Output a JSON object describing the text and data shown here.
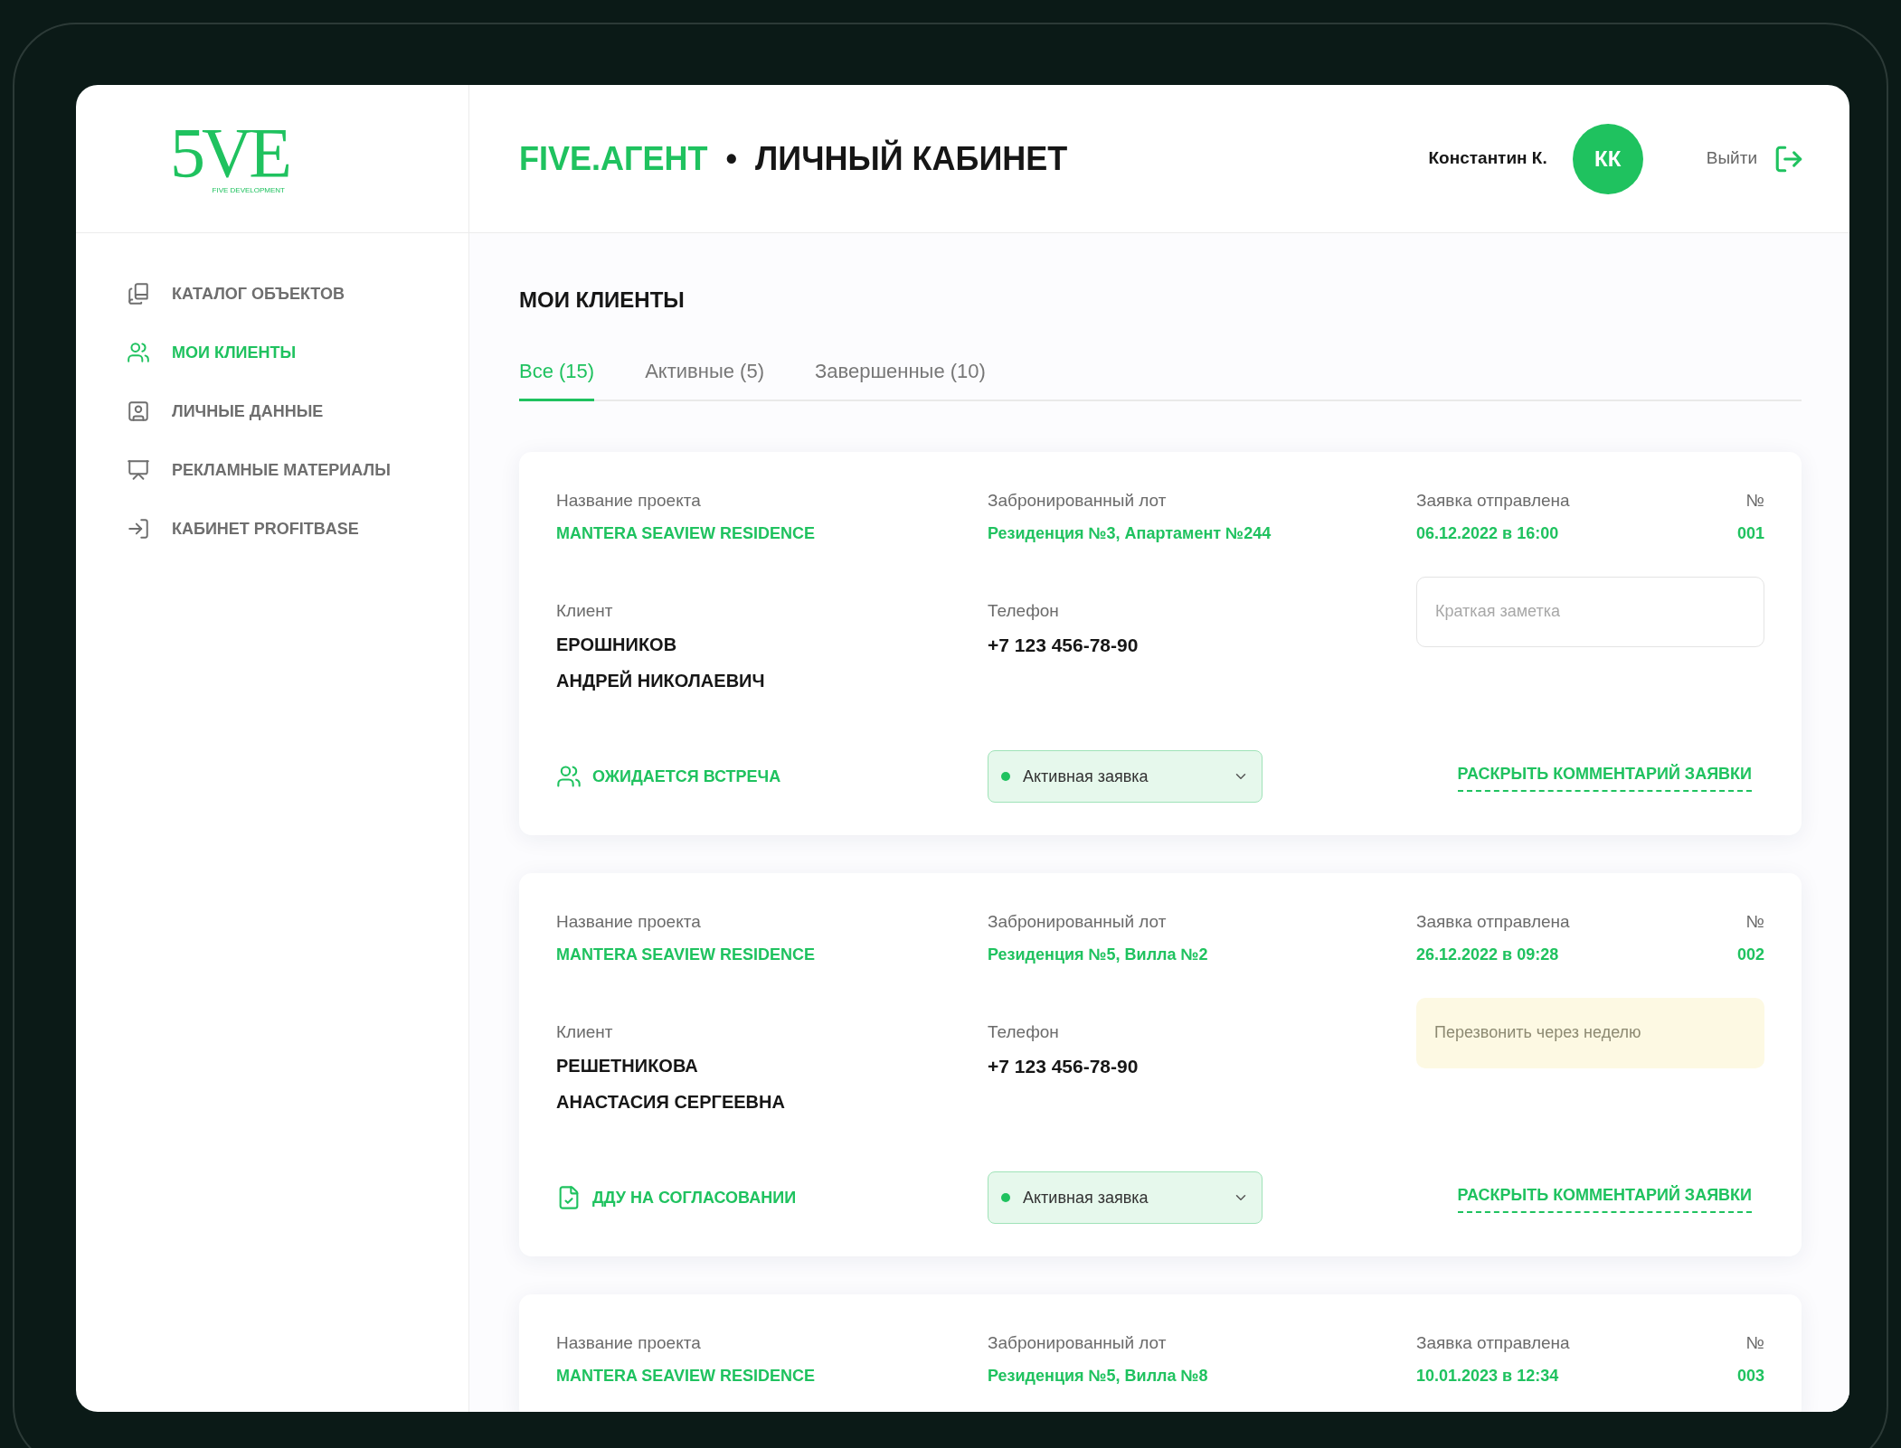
{
  "logo": {
    "mark": "5VE",
    "subtitle": "FIVE DEVELOPMENT"
  },
  "header": {
    "brand": "FIVE.АГЕНТ",
    "separator": "•",
    "title": "ЛИЧНЫЙ КАБИНЕТ",
    "user_name": "Константин К.",
    "avatar_initials": "КК",
    "logout": "Выйти"
  },
  "sidebar": {
    "items": [
      {
        "kind": "catalog",
        "label": "КАТАЛОГ ОБЪЕКТОВ",
        "selected": false
      },
      {
        "kind": "clients",
        "label": "МОИ КЛИЕНТЫ",
        "selected": true
      },
      {
        "kind": "profile",
        "label": "ЛИЧНЫЕ ДАННЫЕ",
        "selected": false
      },
      {
        "kind": "presentation",
        "label": "РЕКЛАМНЫЕ МАТЕРИАЛЫ",
        "selected": false
      },
      {
        "kind": "login",
        "label": "КАБИНЕТ PROFITBASE",
        "selected": false
      }
    ]
  },
  "page_title": "МОИ КЛИЕНТЫ",
  "tabs": [
    {
      "label": "Все (15)",
      "selected": true
    },
    {
      "label": "Активные (5)",
      "selected": false
    },
    {
      "label": "Завершенные (10)",
      "selected": false
    }
  ],
  "cards": [
    {
      "project": {
        "label": "Название проекта",
        "value": "MANTERA SEAVIEW RESIDENCE"
      },
      "lot": {
        "label": "Забронированный лот",
        "value": "Резиденция №3, Апартамент №244"
      },
      "sent": {
        "label": "Заявка отправлена",
        "value": "06.12.2022 в 16:00"
      },
      "number": {
        "label": "№",
        "value": "001"
      },
      "client": {
        "label": "Клиент",
        "lines": [
          "ЕРОШНИКОВ",
          "АНДРЕЙ НИКОЛАЕВИЧ"
        ]
      },
      "phone": {
        "label": "Телефон",
        "value": "+7 123 456-78-90"
      },
      "note": {
        "placeholder": "Краткая заметка"
      },
      "stage": {
        "kind": "meeting",
        "label": "ОЖИДАЕТСЯ ВСТРЕЧА"
      },
      "status": {
        "label": "Активная заявка",
        "color": "#1fc25f"
      },
      "comment_link": "РАСКРЫТЬ КОММЕНТАРИЙ ЗАЯВКИ"
    },
    {
      "project": {
        "label": "Название проекта",
        "value": "MANTERA SEAVIEW RESIDENCE"
      },
      "lot": {
        "label": "Забронированный лот",
        "value": "Резиденция №5, Вилла №2"
      },
      "sent": {
        "label": "Заявка отправлена",
        "value": "26.12.2022 в 09:28"
      },
      "number": {
        "label": "№",
        "value": "002"
      },
      "client": {
        "label": "Клиент",
        "lines": [
          "РЕШЕТНИКОВА",
          "АНАСТАСИЯ СЕРГЕЕВНА"
        ]
      },
      "phone": {
        "label": "Телефон",
        "value": "+7 123 456-78-90"
      },
      "note": {
        "value": "Перезвонить через неделю"
      },
      "stage": {
        "kind": "contract",
        "label": "ДДУ НА СОГЛАСОВАНИИ"
      },
      "status": {
        "label": "Активная заявка",
        "color": "#1fc25f"
      },
      "comment_link": "РАСКРЫТЬ КОММЕНТАРИЙ ЗАЯВКИ"
    },
    {
      "project": {
        "label": "Название проекта",
        "value": "MANTERA SEAVIEW RESIDENCE"
      },
      "lot": {
        "label": "Забронированный лот",
        "value": "Резиденция №5, Вилла №8"
      },
      "sent": {
        "label": "Заявка отправлена",
        "value": "10.01.2023 в 12:34"
      },
      "number": {
        "label": "№",
        "value": "003"
      }
    }
  ]
}
